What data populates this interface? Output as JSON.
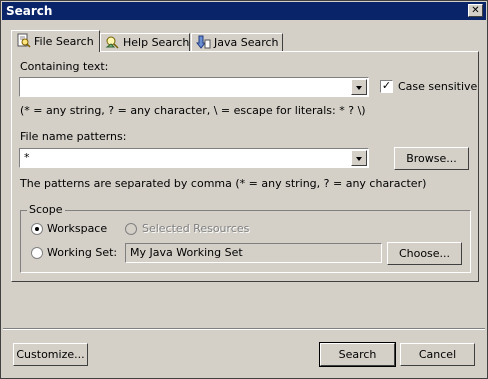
{
  "window": {
    "title": "Search",
    "close_glyph": "✕"
  },
  "tabs": [
    {
      "label": "File Search",
      "icon": "file-search-icon",
      "active": true
    },
    {
      "label": "Help Search",
      "icon": "help-search-icon",
      "active": false
    },
    {
      "label": "Java Search",
      "icon": "java-search-icon",
      "active": false
    }
  ],
  "file_search": {
    "containing_text_label": "Containing text:",
    "containing_text_value": "",
    "case_sensitive_label": "Case sensitive",
    "case_sensitive_checked": true,
    "containing_hint": "(* = any string, ? = any character, \\ = escape for literals: * ? \\)",
    "file_patterns_label": "File name patterns:",
    "file_patterns_value": "*",
    "browse_label": "Browse...",
    "patterns_hint": "The patterns are separated by comma (* = any string, ? = any character)"
  },
  "scope": {
    "legend": "Scope",
    "workspace_label": "Workspace",
    "selected_resources_label": "Selected Resources",
    "working_set_label": "Working Set:",
    "working_set_value": "My Java Working Set",
    "choose_label": "Choose...",
    "selected": "workspace"
  },
  "footer": {
    "customize_label": "Customize...",
    "search_label": "Search",
    "cancel_label": "Cancel"
  },
  "colors": {
    "titlebar": "#0a246a",
    "dialog": "#d4d0c8"
  }
}
